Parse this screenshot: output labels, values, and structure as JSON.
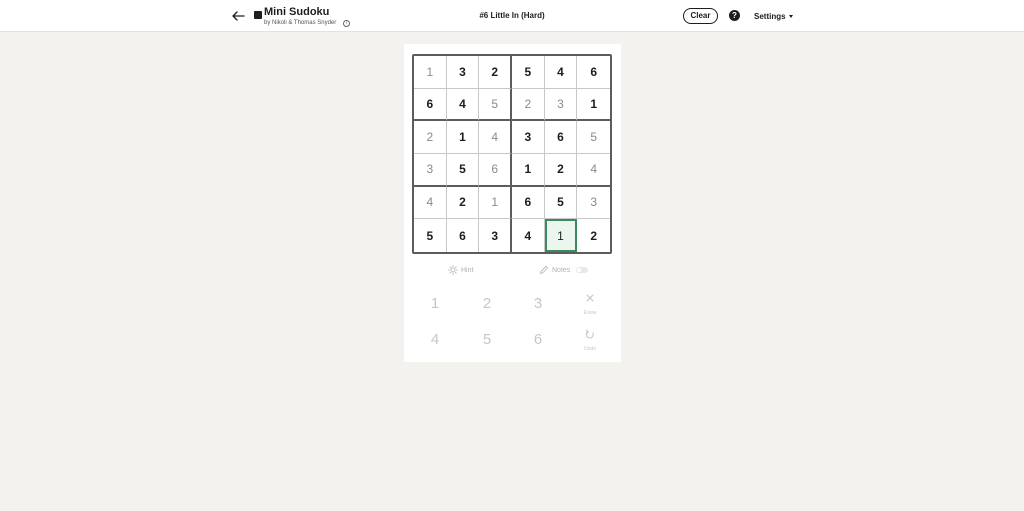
{
  "header": {
    "title": "Mini Sudoku",
    "byline": "by Nikoli & Thomas Snyder",
    "puzzle_title": "#6 Little In (Hard)",
    "clear_label": "Clear",
    "help_label": "?",
    "settings_label": "Settings",
    "info_label": "i"
  },
  "board": {
    "rows": [
      [
        {
          "v": "1",
          "given": false
        },
        {
          "v": "3",
          "given": true
        },
        {
          "v": "2",
          "given": true
        },
        {
          "v": "5",
          "given": true
        },
        {
          "v": "4",
          "given": true
        },
        {
          "v": "6",
          "given": true
        }
      ],
      [
        {
          "v": "6",
          "given": true
        },
        {
          "v": "4",
          "given": true
        },
        {
          "v": "5",
          "given": false
        },
        {
          "v": "2",
          "given": false
        },
        {
          "v": "3",
          "given": false
        },
        {
          "v": "1",
          "given": true
        }
      ],
      [
        {
          "v": "2",
          "given": false
        },
        {
          "v": "1",
          "given": true
        },
        {
          "v": "4",
          "given": false
        },
        {
          "v": "3",
          "given": true
        },
        {
          "v": "6",
          "given": true
        },
        {
          "v": "5",
          "given": false
        }
      ],
      [
        {
          "v": "3",
          "given": false
        },
        {
          "v": "5",
          "given": true
        },
        {
          "v": "6",
          "given": false
        },
        {
          "v": "1",
          "given": true
        },
        {
          "v": "2",
          "given": true
        },
        {
          "v": "4",
          "given": false
        }
      ],
      [
        {
          "v": "4",
          "given": false
        },
        {
          "v": "2",
          "given": true
        },
        {
          "v": "1",
          "given": false
        },
        {
          "v": "6",
          "given": true
        },
        {
          "v": "5",
          "given": true
        },
        {
          "v": "3",
          "given": false
        }
      ],
      [
        {
          "v": "5",
          "given": true
        },
        {
          "v": "6",
          "given": true
        },
        {
          "v": "3",
          "given": true
        },
        {
          "v": "4",
          "given": true
        },
        {
          "v": "1",
          "given": false
        },
        {
          "v": "2",
          "given": true
        }
      ]
    ],
    "selected": {
      "row": 5,
      "col": 4
    }
  },
  "tools": {
    "hint_label": "Hint",
    "notes_label": "Notes",
    "notes_state": "off"
  },
  "keypad": {
    "numbers": [
      "1",
      "2",
      "3",
      "4",
      "5",
      "6"
    ],
    "erase_label": "Erase",
    "undo_label": "Undo"
  },
  "colors": {
    "background": "#f3f2ef",
    "selected_border": "#3c8a5f",
    "selected_fill": "#ebf6ef"
  }
}
